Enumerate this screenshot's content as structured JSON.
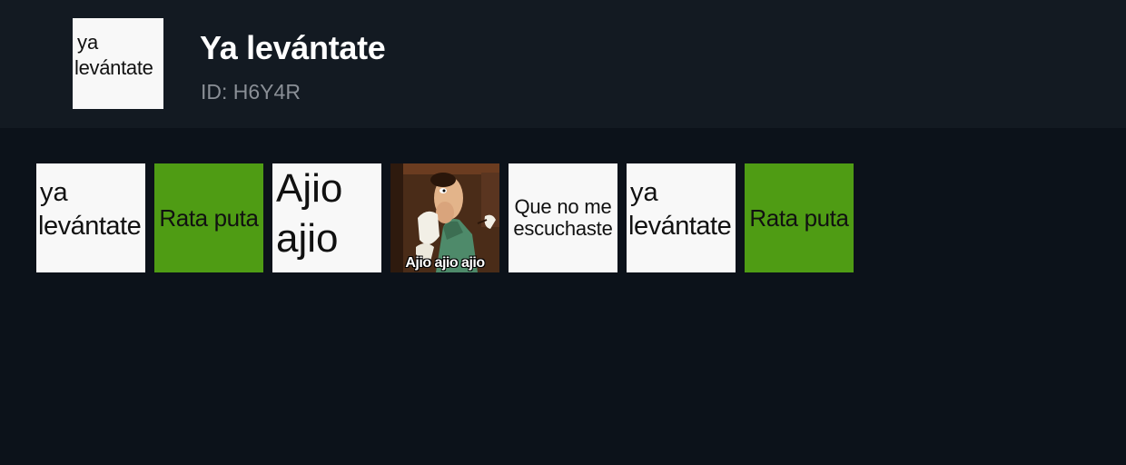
{
  "header": {
    "thumbnail": {
      "line1": "ya",
      "line2": "levántate"
    },
    "title": "Ya levántate",
    "subtitle": "ID: H6Y4R"
  },
  "tiles": [
    {
      "style": "white",
      "lines": [
        "ya",
        "levántate"
      ]
    },
    {
      "style": "green",
      "text": "Rata puta"
    },
    {
      "style": "white",
      "lines": [
        "Ajio",
        "ajio"
      ]
    },
    {
      "style": "image",
      "caption": "Ajio ajio ajio"
    },
    {
      "style": "white",
      "lines": [
        "Que no me",
        "escuchaste"
      ]
    },
    {
      "style": "white",
      "lines": [
        "ya",
        "levántate"
      ]
    },
    {
      "style": "green",
      "text": "Rata puta"
    }
  ],
  "colors": {
    "background": "#0c121a",
    "header_background": "#131a22",
    "tile_white": "#f8f8f8",
    "tile_green": "#4f9c14",
    "subtitle_text": "#8a8f96"
  }
}
